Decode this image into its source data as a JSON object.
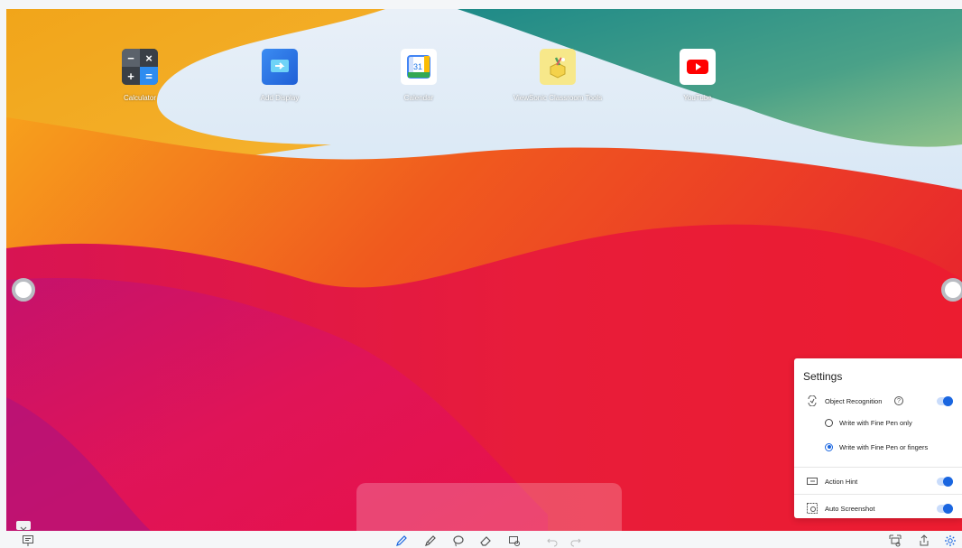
{
  "apps": [
    {
      "label": "Calculator",
      "icon": "calculator-icon"
    },
    {
      "label": "Add Display",
      "icon": "add-display-icon"
    },
    {
      "label": "Calendar",
      "icon": "calendar-icon",
      "day": "31"
    },
    {
      "label": "ViewSonic Classroom Tools",
      "icon": "classroom-tools-icon"
    },
    {
      "label": "YouTube",
      "icon": "youtube-icon"
    }
  ],
  "calculator_keys": [
    "−",
    "×",
    "+",
    "="
  ],
  "settings": {
    "title": "Settings",
    "object_recognition": {
      "label": "Object Recognition",
      "help": "?",
      "enabled": true
    },
    "write_options": [
      {
        "label": "Write with Fine Pen only",
        "selected": false
      },
      {
        "label": "Write with Fine Pen or fingers",
        "selected": true
      }
    ],
    "action_hint": {
      "label": "Action Hint",
      "enabled": true
    },
    "auto_screenshot": {
      "label": "Auto Screenshot",
      "enabled": true
    }
  },
  "toolbar": {
    "left": [
      "whiteboard-icon"
    ],
    "center": [
      "pen-icon",
      "highlighter-icon",
      "lasso-icon",
      "eraser-icon",
      "screenshot-tool-icon",
      "undo-icon",
      "redo-icon"
    ],
    "right": [
      "capture-icon",
      "share-icon",
      "settings-gear-icon"
    ]
  },
  "colors": {
    "accent": "#1a66e0",
    "active_tool": "#1a66e0"
  }
}
